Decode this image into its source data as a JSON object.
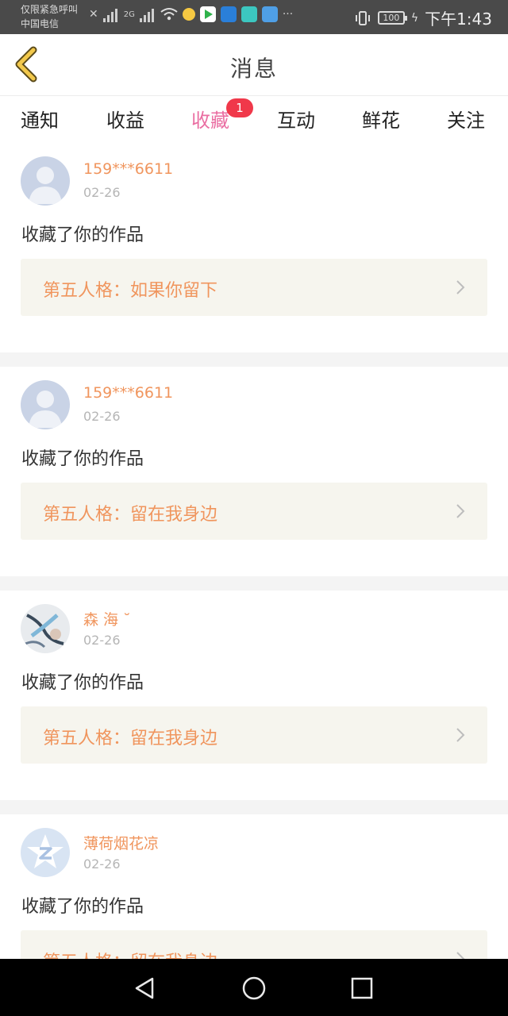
{
  "status_bar": {
    "line1": "仅限紧急呼叫",
    "line2": "中国电信",
    "net_label": "2G",
    "battery": "100",
    "time": "下午1:43"
  },
  "header": {
    "title": "消息"
  },
  "tabs": [
    {
      "label": "通知"
    },
    {
      "label": "收益"
    },
    {
      "label": "收藏",
      "badge": "1",
      "active": true
    },
    {
      "label": "互动"
    },
    {
      "label": "鲜花"
    },
    {
      "label": "关注"
    }
  ],
  "items": [
    {
      "username": "159***6611",
      "date": "02-26",
      "action": "收藏了你的作品",
      "work": "第五人格：如果你留下",
      "avatar": "default-avatar"
    },
    {
      "username": "159***6611",
      "date": "02-26",
      "action": "收藏了你的作品",
      "work": "第五人格：留在我身边",
      "avatar": "default-avatar"
    },
    {
      "username": "森 海 ˘",
      "date": "02-26",
      "action": "收藏了你的作品",
      "work": "第五人格：留在我身边",
      "avatar": "artwork-avatar"
    },
    {
      "username": "薄荷烟花凉",
      "date": "02-26",
      "action": "收藏了你的作品",
      "work": "第五人格：留在我身边",
      "avatar": "qzone-star-avatar"
    }
  ],
  "colors": {
    "accent": "#ea6ea2",
    "username": "#f0955d",
    "badge": "#f0384a",
    "back_arrow": "#f2c84b",
    "work_bg": "#f6f5ee"
  }
}
